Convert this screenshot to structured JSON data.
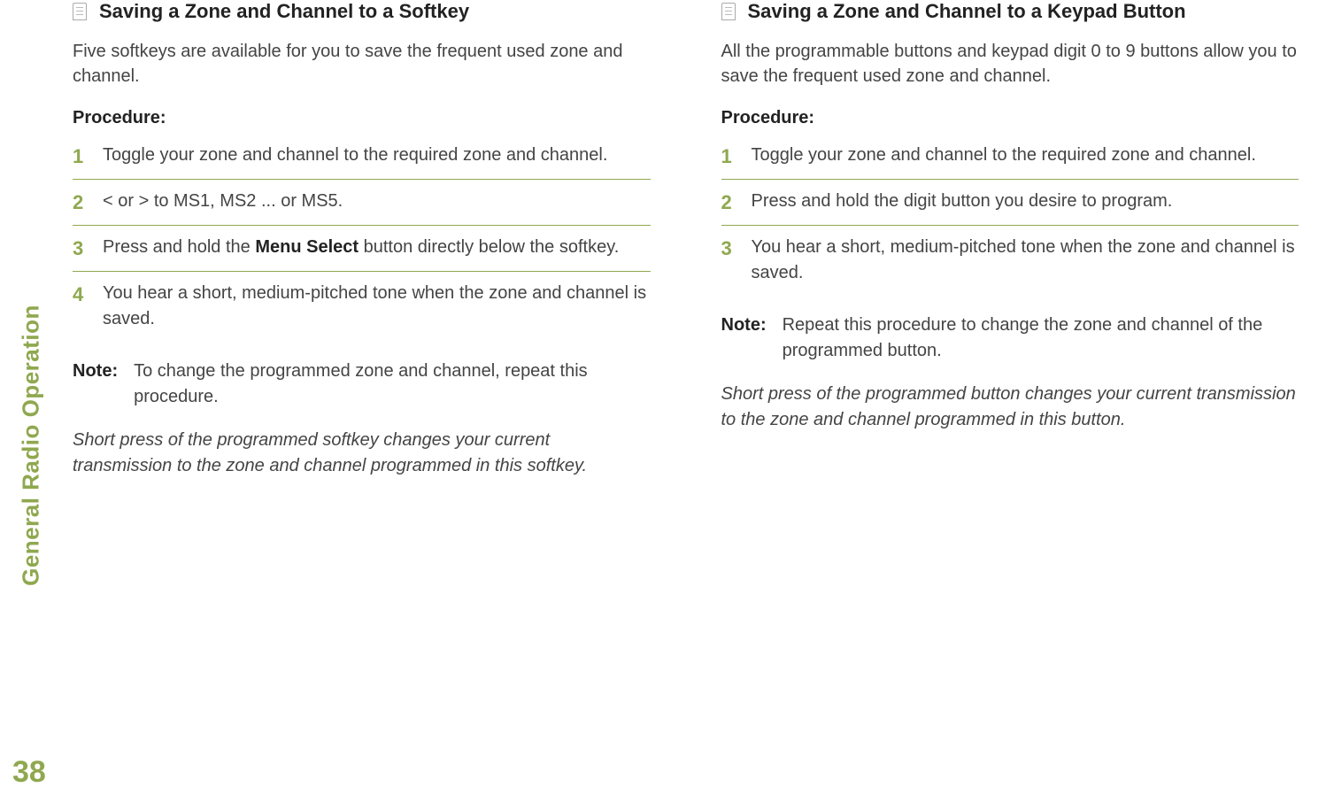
{
  "sidebar": {
    "label": "General Radio Operation",
    "page_number": "38"
  },
  "left": {
    "heading": "Saving a Zone and Channel to a Softkey",
    "lead": "Five softkeys are available for you to save the frequent used zone and channel.",
    "procedure_label": "Procedure:",
    "steps": {
      "s1": "Toggle your zone and channel to the required zone and channel.",
      "s2_pre": "< or > to MS1, MS2 ... or MS5.",
      "s3_pre": "Press and hold the ",
      "s3_bold": "Menu Select",
      "s3_post": " button directly below the softkey.",
      "s4": "You hear a short, medium-pitched tone when the zone and channel is saved."
    },
    "note_label": "Note:",
    "note_text": "To change the programmed zone and channel, repeat this procedure.",
    "italic": "Short press of the programmed softkey changes your current transmission to the zone and channel programmed in this softkey."
  },
  "right": {
    "heading": "Saving a Zone and Channel to a Keypad Button",
    "lead": "All the programmable buttons and keypad digit 0 to 9 buttons allow you to save the frequent used zone and channel.",
    "procedure_label": "Procedure:",
    "steps": {
      "s1": "Toggle your zone and channel to the required zone and channel.",
      "s2": "Press and hold the digit button you desire to program.",
      "s3": "You hear a short, medium-pitched tone when the zone and channel is saved."
    },
    "note_label": "Note:",
    "note_text": "Repeat this procedure to change the zone and channel of the programmed button.",
    "italic": "Short press of the programmed button changes your current transmission to the zone and channel programmed in this button."
  }
}
